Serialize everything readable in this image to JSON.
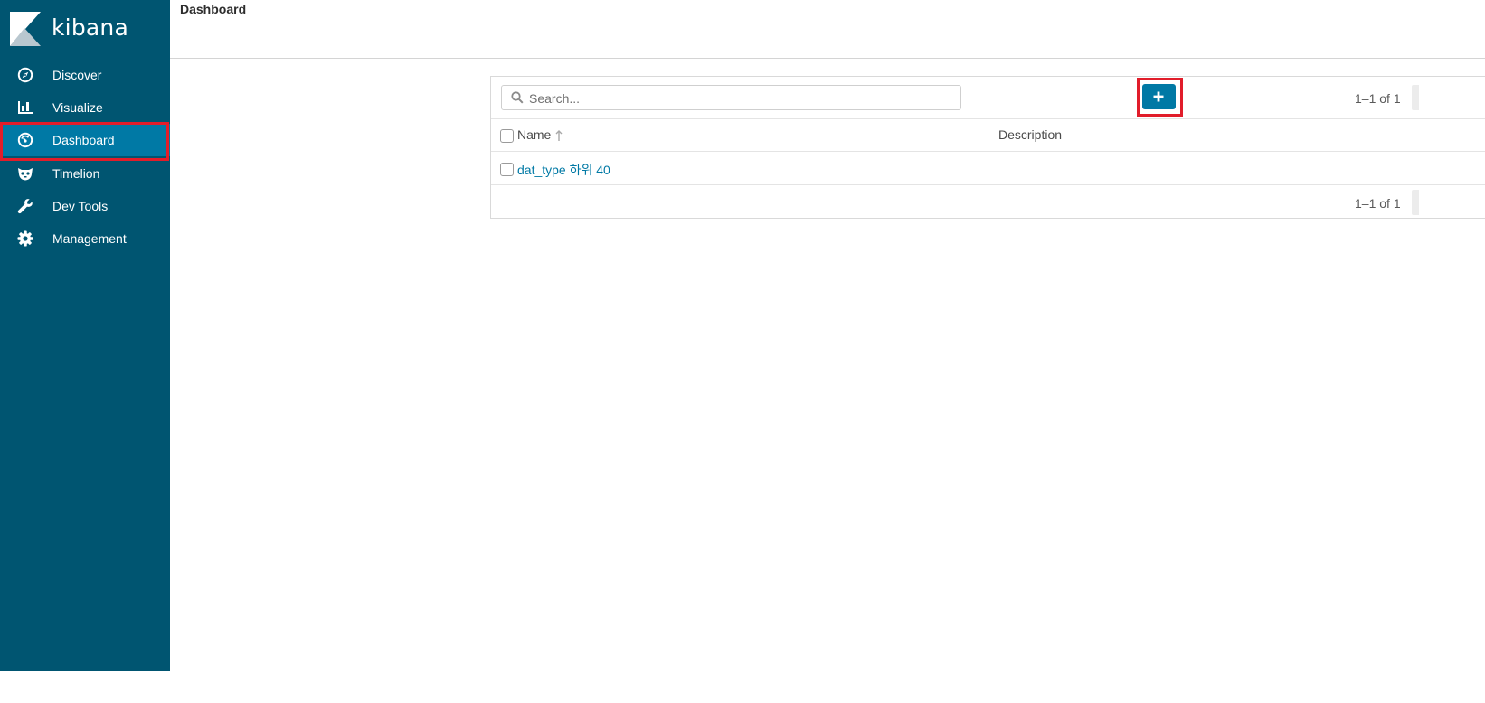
{
  "app": {
    "name": "kibana"
  },
  "sidebar": {
    "items": [
      {
        "label": "Discover",
        "icon": "compass-icon"
      },
      {
        "label": "Visualize",
        "icon": "bar-chart-icon"
      },
      {
        "label": "Dashboard",
        "icon": "gauge-icon",
        "active": true
      },
      {
        "label": "Timelion",
        "icon": "timelion-mask-icon"
      },
      {
        "label": "Dev Tools",
        "icon": "wrench-icon"
      },
      {
        "label": "Management",
        "icon": "gear-icon"
      }
    ]
  },
  "header": {
    "title": "Dashboard"
  },
  "listing": {
    "search": {
      "placeholder": "Search...",
      "value": ""
    },
    "add_button": {
      "icon": "plus-icon"
    },
    "pagination_top": "1–1 of 1",
    "pagination_bottom": "1–1 of 1",
    "columns": {
      "name": "Name",
      "description": "Description"
    },
    "rows": [
      {
        "name": "dat_type 하위 40",
        "description": ""
      }
    ]
  },
  "colors": {
    "sidebar_bg": "#005571",
    "active_bg": "#0079a5",
    "accent": "#0079a5",
    "annotation_highlight": "#e11d2a"
  }
}
